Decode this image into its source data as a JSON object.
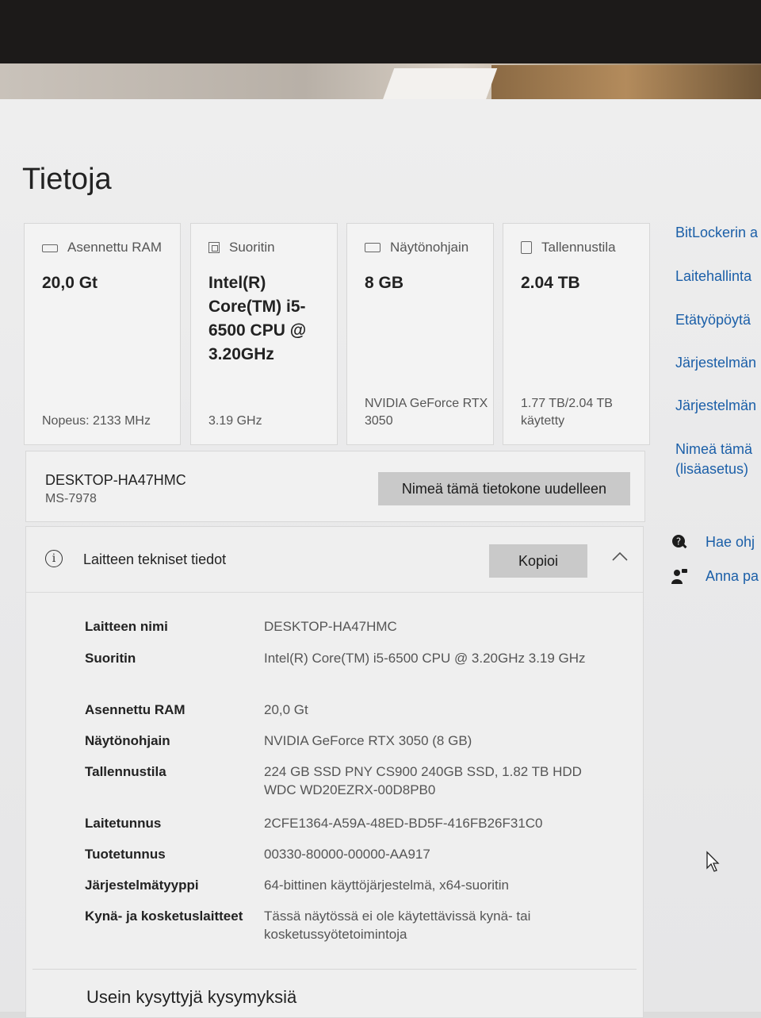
{
  "page": {
    "title": "Tietoja"
  },
  "cards": [
    {
      "icon": "ram-icon",
      "title": "Asennettu RAM",
      "value": "20,0 Gt",
      "sub": "Nopeus: 2133 MHz"
    },
    {
      "icon": "processor-icon",
      "title": "Suoritin",
      "value": "Intel(R) Core(TM) i5-6500 CPU @ 3.20GHz",
      "sub": "3.19 GHz"
    },
    {
      "icon": "graphics-card-icon",
      "title": "Näytönohjain",
      "value": "8 GB",
      "sub": "NVIDIA GeForce RTX 3050"
    },
    {
      "icon": "storage-icon",
      "title": "Tallennustila",
      "value": "2.04 TB",
      "sub": "1.77 TB/2.04 TB käytetty"
    }
  ],
  "device": {
    "name": "DESKTOP-HA47HMC",
    "model": "MS-7978",
    "rename_label": "Nimeä tämä tietokone uudelleen"
  },
  "specs": {
    "title": "Laitteen tekniset tiedot",
    "copy_label": "Kopioi",
    "rows": [
      {
        "key": "Laitteen nimi",
        "value": "DESKTOP-HA47HMC"
      },
      {
        "key": "Suoritin",
        "value": "Intel(R) Core(TM) i5-6500 CPU @ 3.20GHz   3.19 GHz"
      },
      {
        "key": "Asennettu RAM",
        "value": "20,0 Gt"
      },
      {
        "key": "Näytönohjain",
        "value": "NVIDIA GeForce RTX 3050 (8 GB)"
      },
      {
        "key": "Tallennustila",
        "value": "224 GB SSD PNY CS900 240GB SSD, 1.82 TB HDD WDC WD20EZRX-00D8PB0"
      },
      {
        "key": "Laitetunnus",
        "value": "2CFE1364-A59A-48ED-BD5F-416FB26F31C0"
      },
      {
        "key": "Tuotetunnus",
        "value": "00330-80000-00000-AA917"
      },
      {
        "key": "Järjestelmätyyppi",
        "value": "64-bittinen käyttöjärjestelmä, x64-suoritin"
      },
      {
        "key": "Kynä- ja kosketuslaitteet",
        "value": "Tässä näytössä ei ole käytettävissä kynä- tai kosketussyötetoimintoja"
      }
    ]
  },
  "faq": {
    "title": "Usein kysyttyjä kysymyksiä"
  },
  "related_links": [
    "BitLockerin a",
    "Laitehallinta",
    "Etätyöpöytä",
    "Järjestelmän",
    "Järjestelmän",
    "Nimeä tämä",
    "(lisäasetus)"
  ],
  "help": [
    {
      "icon": "help-icon",
      "label": "Hae ohj"
    },
    {
      "icon": "feedback-icon",
      "label": "Anna pa"
    }
  ]
}
